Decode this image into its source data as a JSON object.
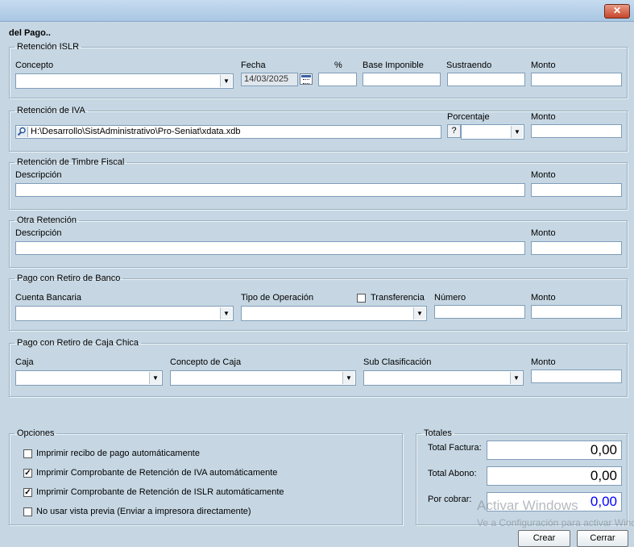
{
  "window": {
    "close_label": "✕",
    "heading": "del Pago.."
  },
  "islr": {
    "legend": "Retención ISLR",
    "concepto_label": "Concepto",
    "fecha_label": "Fecha",
    "fecha_value": "14/03/2025",
    "pct_label": "%",
    "base_label": "Base Imponible",
    "sustraendo_label": "Sustraendo",
    "monto_label": "Monto",
    "concepto_value": "",
    "pct_value": "",
    "base_value": "",
    "sustraendo_value": "",
    "monto_value": ""
  },
  "iva": {
    "legend": "Retención de IVA",
    "path_value": "H:\\Desarrollo\\SistAdministrativo\\Pro-Seniat\\xdata.xdb",
    "porcentaje_label": "Porcentaje",
    "porcentaje_help": "?",
    "monto_label": "Monto",
    "porcentaje_value": "",
    "monto_value": ""
  },
  "timbre": {
    "legend": "Retención de Timbre Fiscal",
    "descripcion_label": "Descripción",
    "monto_label": "Monto",
    "descripcion_value": "",
    "monto_value": ""
  },
  "otra": {
    "legend": "Otra Retención",
    "descripcion_label": "Descripción",
    "monto_label": "Monto",
    "descripcion_value": "",
    "monto_value": ""
  },
  "banco": {
    "legend": "Pago con Retiro de Banco",
    "cuenta_label": "Cuenta Bancaria",
    "tipo_label": "Tipo de Operación",
    "transferencia_label": "Transferencia",
    "numero_label": "Número",
    "monto_label": "Monto",
    "transferencia_checked": false
  },
  "caja": {
    "legend": "Pago con Retiro de Caja Chica",
    "caja_label": "Caja",
    "concepto_label": "Concepto de Caja",
    "subclas_label": "Sub Clasificación",
    "monto_label": "Monto"
  },
  "opciones": {
    "legend": "Opciones",
    "items": [
      {
        "label": "Imprimir recibo de pago automáticamente",
        "checked": false,
        "mark": ""
      },
      {
        "label": "Imprimir Comprobante de Retención de IVA automáticamente",
        "checked": true,
        "mark": "✓"
      },
      {
        "label": "Imprimir Comprobante de Retención de ISLR automáticamente",
        "checked": true,
        "mark": "✓"
      },
      {
        "label": "No usar vista previa (Enviar a impresora directamente)",
        "checked": false,
        "mark": ""
      }
    ]
  },
  "totales": {
    "legend": "Totales",
    "factura_label": "Total Factura:",
    "factura_value": "0,00",
    "abono_label": "Total Abono:",
    "abono_value": "0,00",
    "cobrar_label": "Por cobrar:",
    "cobrar_value": "0,00",
    "cobrar_color": "#0000ff"
  },
  "buttons": {
    "crear": "Crear",
    "cerrar": "Cerrar"
  },
  "watermark": {
    "line1": "Activar Windows",
    "line2": "Ve a Configuración para activar Windows."
  }
}
